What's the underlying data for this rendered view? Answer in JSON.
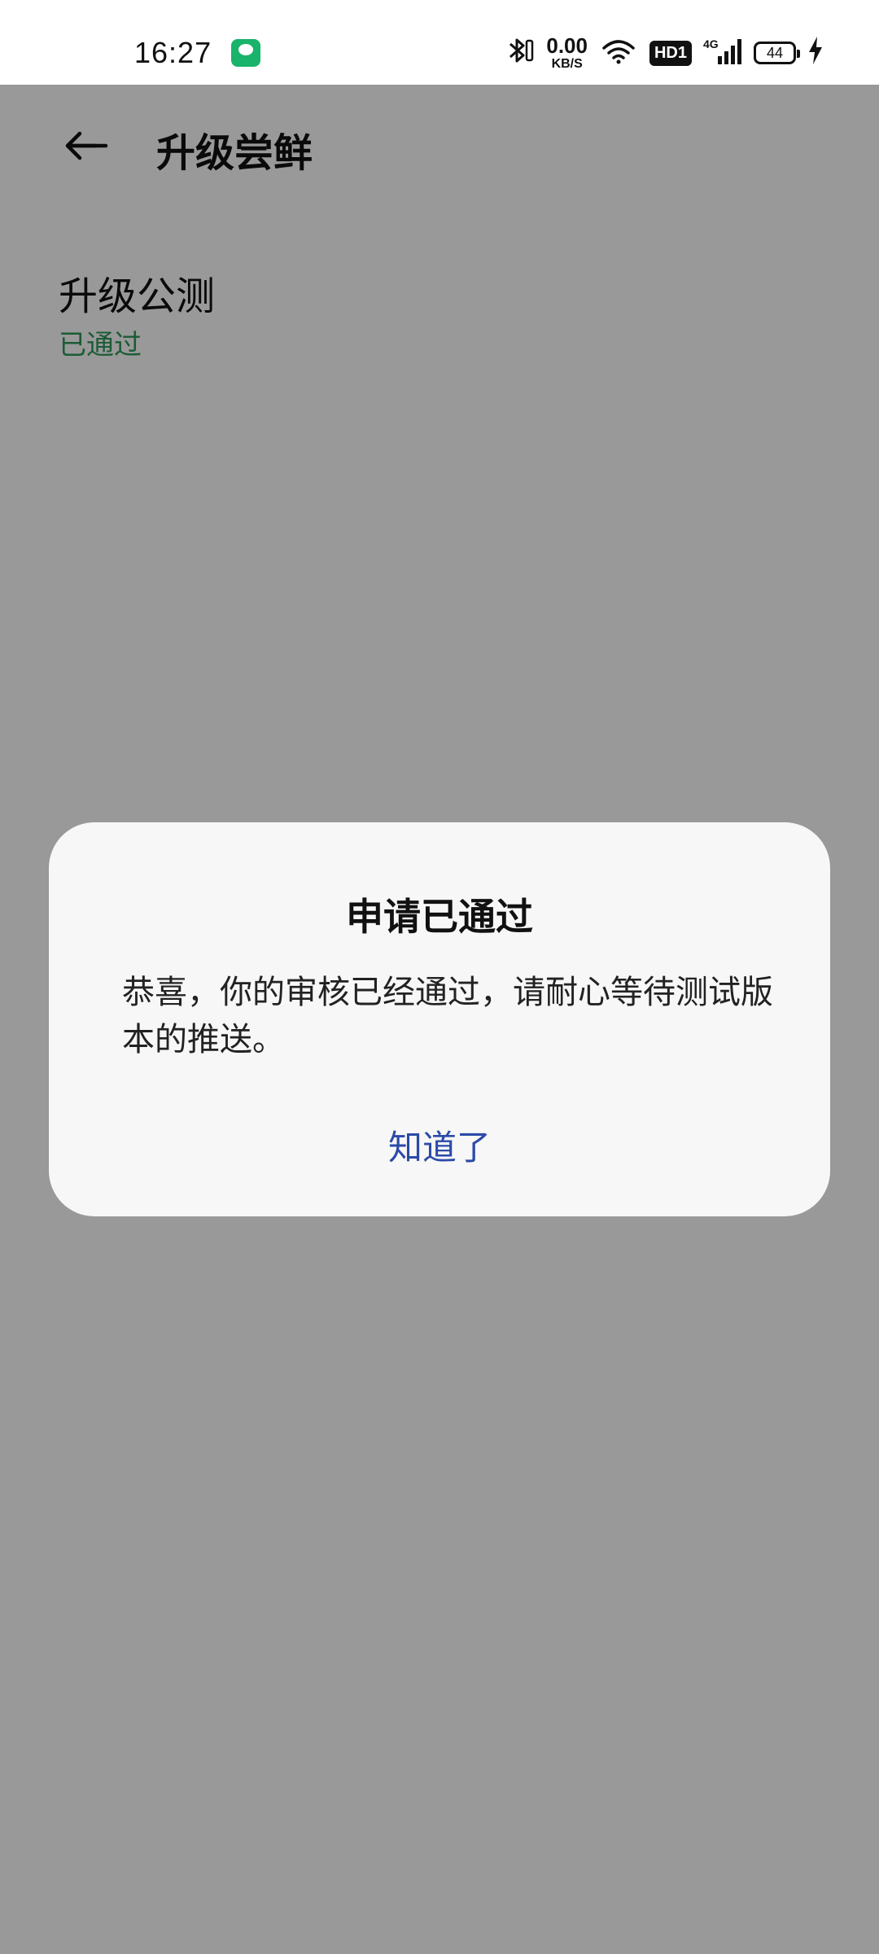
{
  "status_bar": {
    "time": "16:27",
    "net_speed_value": "0.00",
    "net_speed_unit": "KB/S",
    "hd_label": "HD1",
    "network_label": "4G",
    "battery_level": "44"
  },
  "header": {
    "title": "升级尝鲜"
  },
  "section": {
    "title": "升级公测",
    "status": "已通过"
  },
  "dialog": {
    "title": "申请已通过",
    "message": "恭喜，你的审核已经通过，请耐心等待测试版本的推送。",
    "ok_label": "知道了"
  },
  "colors": {
    "status_green": "#2f9a5b",
    "accent_blue": "#2b4aa8",
    "scrim": "rgba(0,0,0,0.4)"
  }
}
